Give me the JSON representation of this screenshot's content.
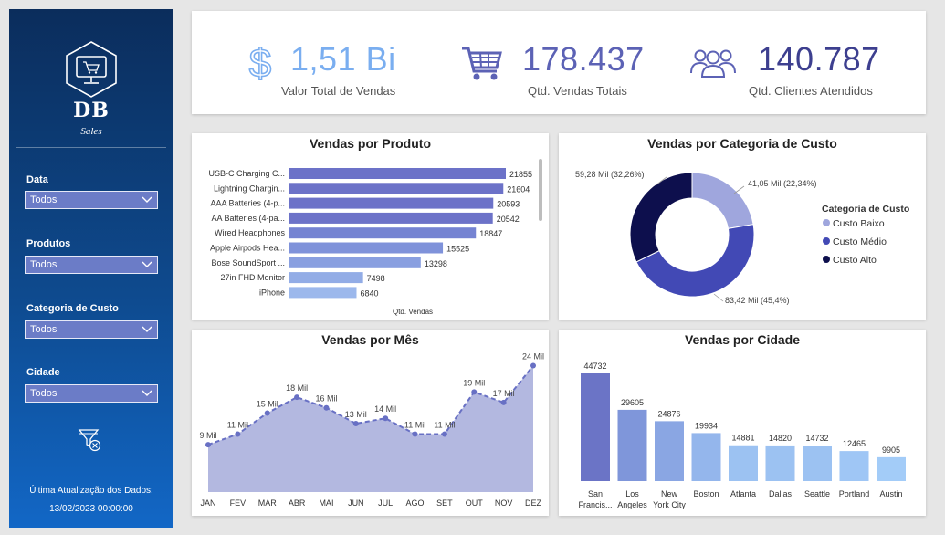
{
  "brand": {
    "title": "DB",
    "subtitle": "Sales"
  },
  "filters": [
    {
      "label": "Data",
      "value": "Todos"
    },
    {
      "label": "Produtos",
      "value": "Todos"
    },
    {
      "label": "Categoria de Custo",
      "value": "Todos"
    },
    {
      "label": "Cidade",
      "value": "Todos"
    }
  ],
  "update": {
    "label": "Última Atualização dos Dados:",
    "value": "13/02/2023 00:00:00"
  },
  "kpis": [
    {
      "value": "1,51 Bi",
      "label": "Valor Total de Vendas",
      "icon": "dollar-icon",
      "color": "#7aaef0"
    },
    {
      "value": "178.437",
      "label": "Qtd. Vendas Totais",
      "icon": "shopping-cart-icon",
      "color": "#5c62b5"
    },
    {
      "value": "140.787",
      "label": "Qtd. Clientes Atendidos",
      "icon": "users-icon",
      "color": "#3d3f8f"
    }
  ],
  "charts": {
    "produto_title": "Vendas por Produto",
    "produto_xlabel": "Qtd. Vendas",
    "categoria_title": "Vendas por Categoria de Custo",
    "mes_title": "Vendas por Mês",
    "cidade_title": "Vendas por Cidade",
    "legend_title": "Categoria de Custo"
  },
  "chart_data": [
    {
      "type": "bar",
      "orientation": "horizontal",
      "title": "Vendas por Produto",
      "xlabel": "Qtd. Vendas",
      "categories": [
        "USB-C Charging C...",
        "Lightning Chargin...",
        "AAA Batteries (4-p...",
        "AA Batteries (4-pa...",
        "Wired Headphones",
        "Apple Airpods Hea...",
        "Bose SoundSport ...",
        "27in FHD Monitor",
        "iPhone"
      ],
      "values": [
        21855,
        21604,
        20593,
        20542,
        18847,
        15525,
        13298,
        7498,
        6840
      ],
      "colors": [
        "#6c72c8",
        "#6c72c8",
        "#6c72c8",
        "#6c72c8",
        "#7583d2",
        "#7f92da",
        "#899fe0",
        "#92ace6",
        "#9cb8ec"
      ]
    },
    {
      "type": "pie",
      "variant": "donut",
      "title": "Vendas por Categoria de Custo",
      "legend_title": "Categoria de Custo",
      "slices": [
        {
          "name": "Custo Baixo",
          "value": 41.05,
          "label": "41,05 Mil (22,34%)",
          "color": "#9fa6dd"
        },
        {
          "name": "Custo Médio",
          "value": 83.42,
          "label": "83,42 Mil (45,4%)",
          "color": "#4249b5"
        },
        {
          "name": "Custo Alto",
          "value": 59.28,
          "label": "59,28 Mil (32,26%)",
          "color": "#0d0f4d"
        }
      ]
    },
    {
      "type": "area",
      "title": "Vendas por Mês",
      "categories": [
        "JAN",
        "FEV",
        "MAR",
        "ABR",
        "MAI",
        "JUN",
        "JUL",
        "AGO",
        "SET",
        "OUT",
        "NOV",
        "DEZ"
      ],
      "values": [
        9,
        11,
        15,
        18,
        16,
        13,
        14,
        11,
        11,
        19,
        17,
        24
      ],
      "labels": [
        "9 Mil",
        "11 Mil",
        "15 Mil",
        "18 Mil",
        "16 Mil",
        "13 Mil",
        "14 Mil",
        "11 Mil",
        "11 Mil",
        "19 Mil",
        "17 Mil",
        "24 Mil"
      ],
      "ylim": [
        0,
        26
      ],
      "color": "#6870c4",
      "fill": "#b3b8e0"
    },
    {
      "type": "bar",
      "orientation": "vertical",
      "title": "Vendas por Cidade",
      "categories": [
        "San Francis...",
        "Los Angeles",
        "New York City",
        "Boston",
        "Atlanta",
        "Dallas",
        "Seattle",
        "Portland",
        "Austin"
      ],
      "category_lines": [
        [
          "San",
          "Francis..."
        ],
        [
          "Los",
          "Angeles"
        ],
        [
          "New",
          "York City"
        ],
        [
          "Boston"
        ],
        [
          "Atlanta"
        ],
        [
          "Dallas"
        ],
        [
          "Seattle"
        ],
        [
          "Portland"
        ],
        [
          "Austin"
        ]
      ],
      "values": [
        44732,
        29605,
        24876,
        19934,
        14881,
        14820,
        14732,
        12465,
        9905
      ],
      "colors": [
        "#6b74c6",
        "#7f96da",
        "#8aa6e3",
        "#94b6ec",
        "#9cc2f2",
        "#9cc2f2",
        "#9cc2f2",
        "#9fc6f5",
        "#a3ccf8"
      ]
    }
  ]
}
